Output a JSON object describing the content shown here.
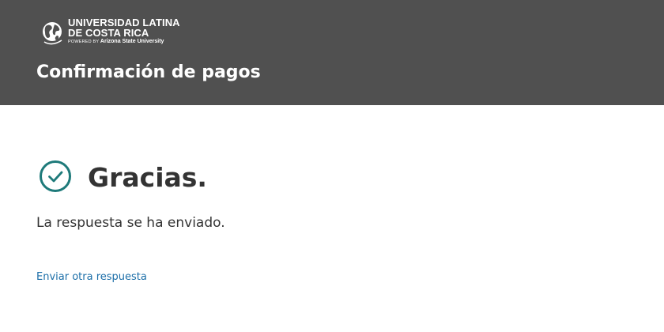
{
  "header": {
    "logo": {
      "line1": "UNIVERSIDAD LATINA",
      "line2": "DE COSTA RICA",
      "line3_prefix": "POWERED BY ",
      "line3_brand": "Arizona State University"
    },
    "title": "Confirmación de pagos",
    "background_color": "#505050"
  },
  "confirmation": {
    "icon": "check-circle-icon",
    "icon_color": "#1e7a7a",
    "heading": "Gracias.",
    "message": "La respuesta se ha enviado."
  },
  "actions": {
    "resend_label": "Enviar otra respuesta",
    "link_color": "#1b6ea8"
  }
}
